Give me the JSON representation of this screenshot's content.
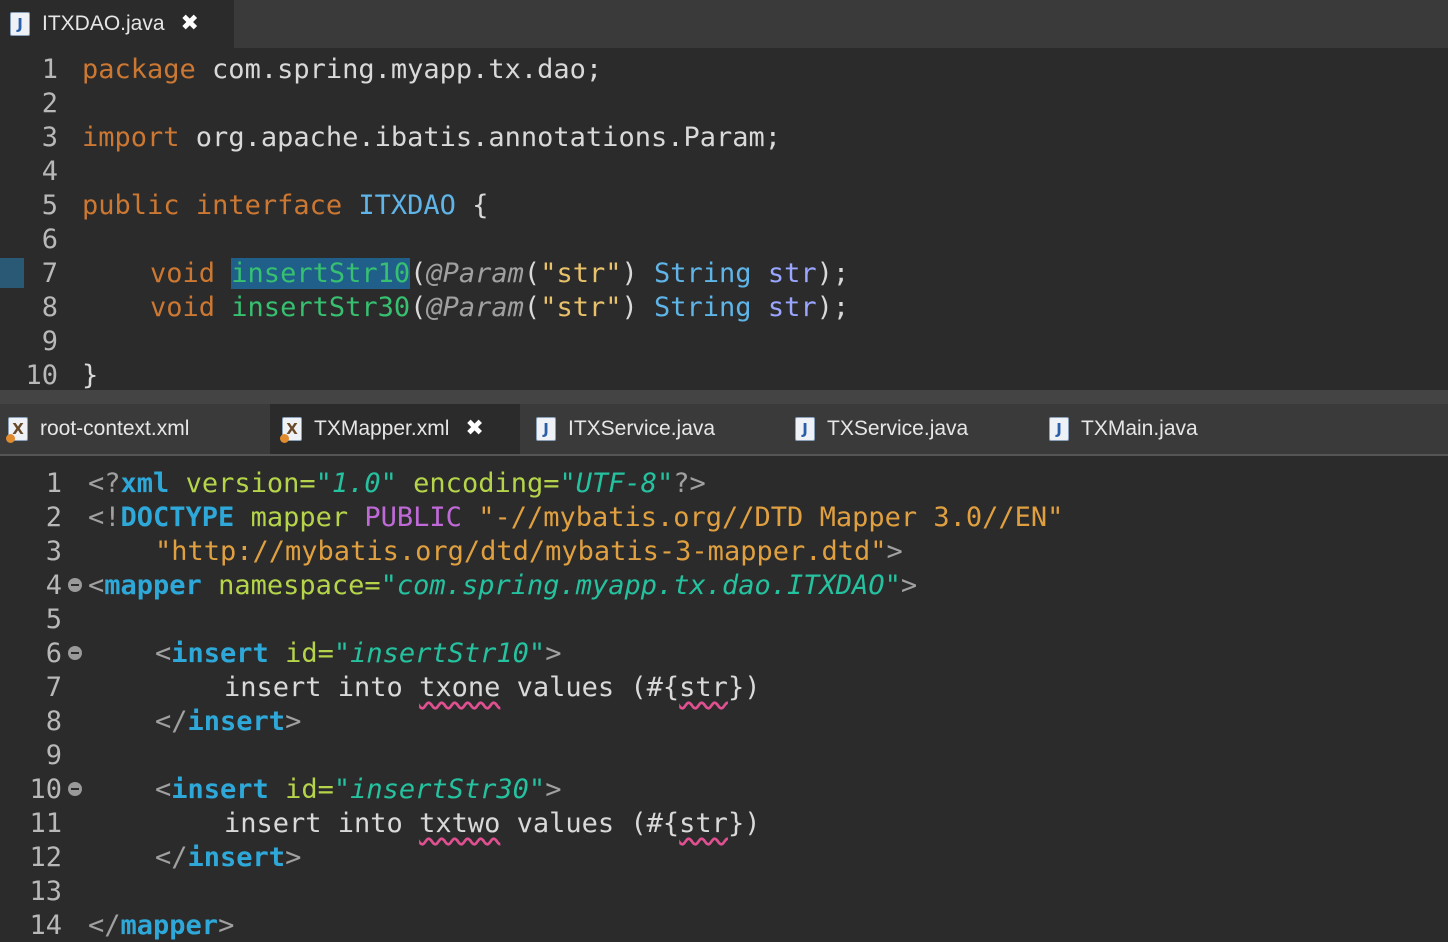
{
  "top_tab": {
    "label": "ITXDAO.java",
    "close": "✖"
  },
  "top_lines": [
    {
      "n": "1"
    },
    {
      "n": "2"
    },
    {
      "n": "3"
    },
    {
      "n": "4"
    },
    {
      "n": "5"
    },
    {
      "n": "6"
    },
    {
      "n": "7"
    },
    {
      "n": "8"
    },
    {
      "n": "9"
    },
    {
      "n": "10"
    }
  ],
  "java": {
    "l1_kw": "package",
    "l1_rest": " com.spring.myapp.tx.dao;",
    "l3_kw": "import",
    "l3_rest": " org.apache.ibatis.annotations.Param;",
    "l5_kw1": "public",
    "l5_kw2": "interface",
    "l5_name": "ITXDAO",
    "l5_brace": " {",
    "void": "void",
    "m1": "insertStr10",
    "m2": "insertStr30",
    "paren_open": "(",
    "ann": "@Param",
    "str_lit": "\"str\"",
    "paren_close": ")",
    "string_type": "String",
    "param": "str",
    "end": ");",
    "l10": "}"
  },
  "bottom_tabs": [
    {
      "label": "root-context.xml",
      "icon": "X"
    },
    {
      "label": "TXMapper.xml",
      "icon": "X",
      "close": "✖"
    },
    {
      "label": "ITXService.java",
      "icon": "J"
    },
    {
      "label": "TXService.java",
      "icon": "J"
    },
    {
      "label": "TXMain.java",
      "icon": "J"
    }
  ],
  "bottom_lines": [
    {
      "n": "1"
    },
    {
      "n": "2"
    },
    {
      "n": "3"
    },
    {
      "n": "4"
    },
    {
      "n": "5"
    },
    {
      "n": "6"
    },
    {
      "n": "7"
    },
    {
      "n": "8"
    },
    {
      "n": "9"
    },
    {
      "n": "10"
    },
    {
      "n": "11"
    },
    {
      "n": "12"
    },
    {
      "n": "13"
    },
    {
      "n": "14"
    }
  ],
  "xml": {
    "l1_open": "<?",
    "l1_tag": "xml",
    "l1_a1": "version",
    "l1_eq": "=",
    "l1_v1": "\"1.0\"",
    "l1_a2": "encoding",
    "l1_v2": "\"UTF-8\"",
    "l1_close": "?>",
    "l2_open": "<!",
    "l2_tag": "DOCTYPE",
    "l2_name": "mapper",
    "l2_public": "PUBLIC",
    "l2_str": "\"-//mybatis.org//DTD Mapper 3.0//EN\"",
    "l3_str": "\"http://mybatis.org/dtd/mybatis-3-mapper.dtd\"",
    "l3_close": ">",
    "lt": "<",
    "gt": ">",
    "lts": "</",
    "mapper": "mapper",
    "namespace": "namespace",
    "ns_val": "\"com.spring.myapp.tx.dao.ITXDAO\"",
    "insert": "insert",
    "id": "id",
    "id1": "\"insertStr10\"",
    "id2": "\"insertStr30\"",
    "sql_a": "insert into ",
    "tbl1": "txone",
    "tbl2": "txtwo",
    "sql_b": " values (#{",
    "sql_var": "str",
    "sql_c": "})"
  }
}
